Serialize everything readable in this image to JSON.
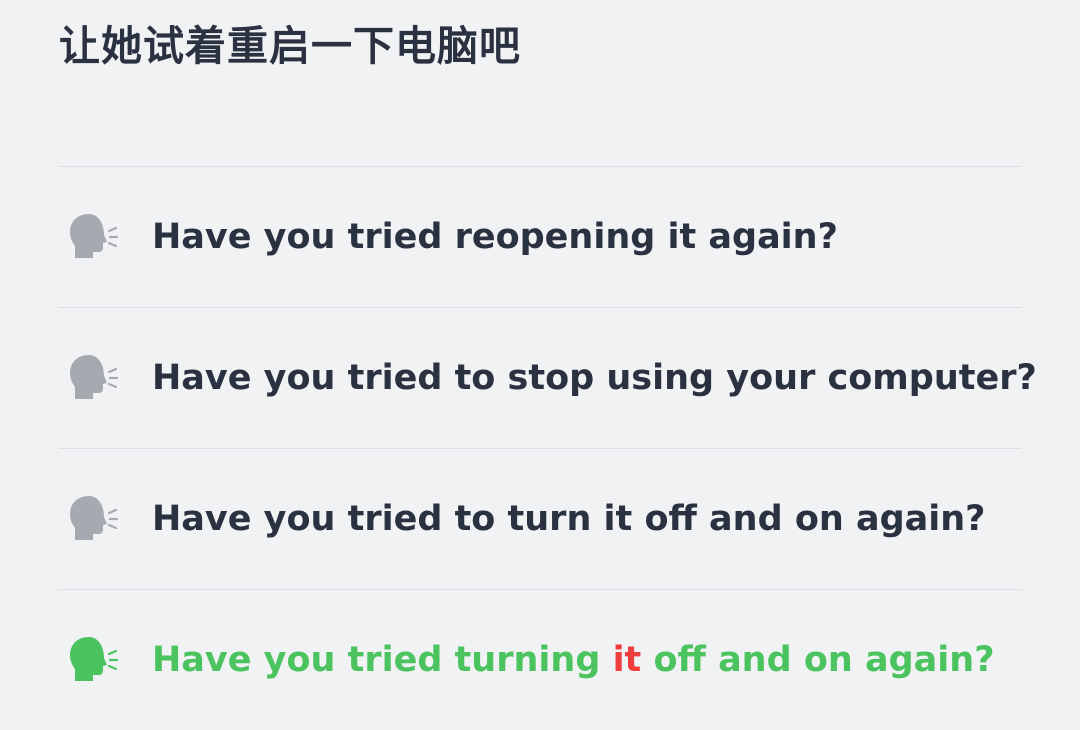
{
  "question": {
    "title": "让她试着重启一下电脑吧"
  },
  "colors": {
    "background": "#f1f2f4",
    "text": "#2a3140",
    "icon_default": "#a6aab0",
    "correct": "#4bc35f",
    "highlight": "#ef3d3d",
    "divider": "#dcdfe3"
  },
  "options": [
    {
      "icon": "speaking-head-icon",
      "label": "Have you tried reopening it again?",
      "selected": false
    },
    {
      "icon": "speaking-head-icon",
      "label": "Have you tried to stop using your computer?",
      "selected": false
    },
    {
      "icon": "speaking-head-icon",
      "label": "Have you tried to turn it off and on again?",
      "selected": false
    },
    {
      "icon": "speaking-head-icon",
      "selected": true,
      "label_parts": {
        "before": "Have you tried turning ",
        "highlight": "it",
        "after": " off and on again?"
      }
    }
  ]
}
